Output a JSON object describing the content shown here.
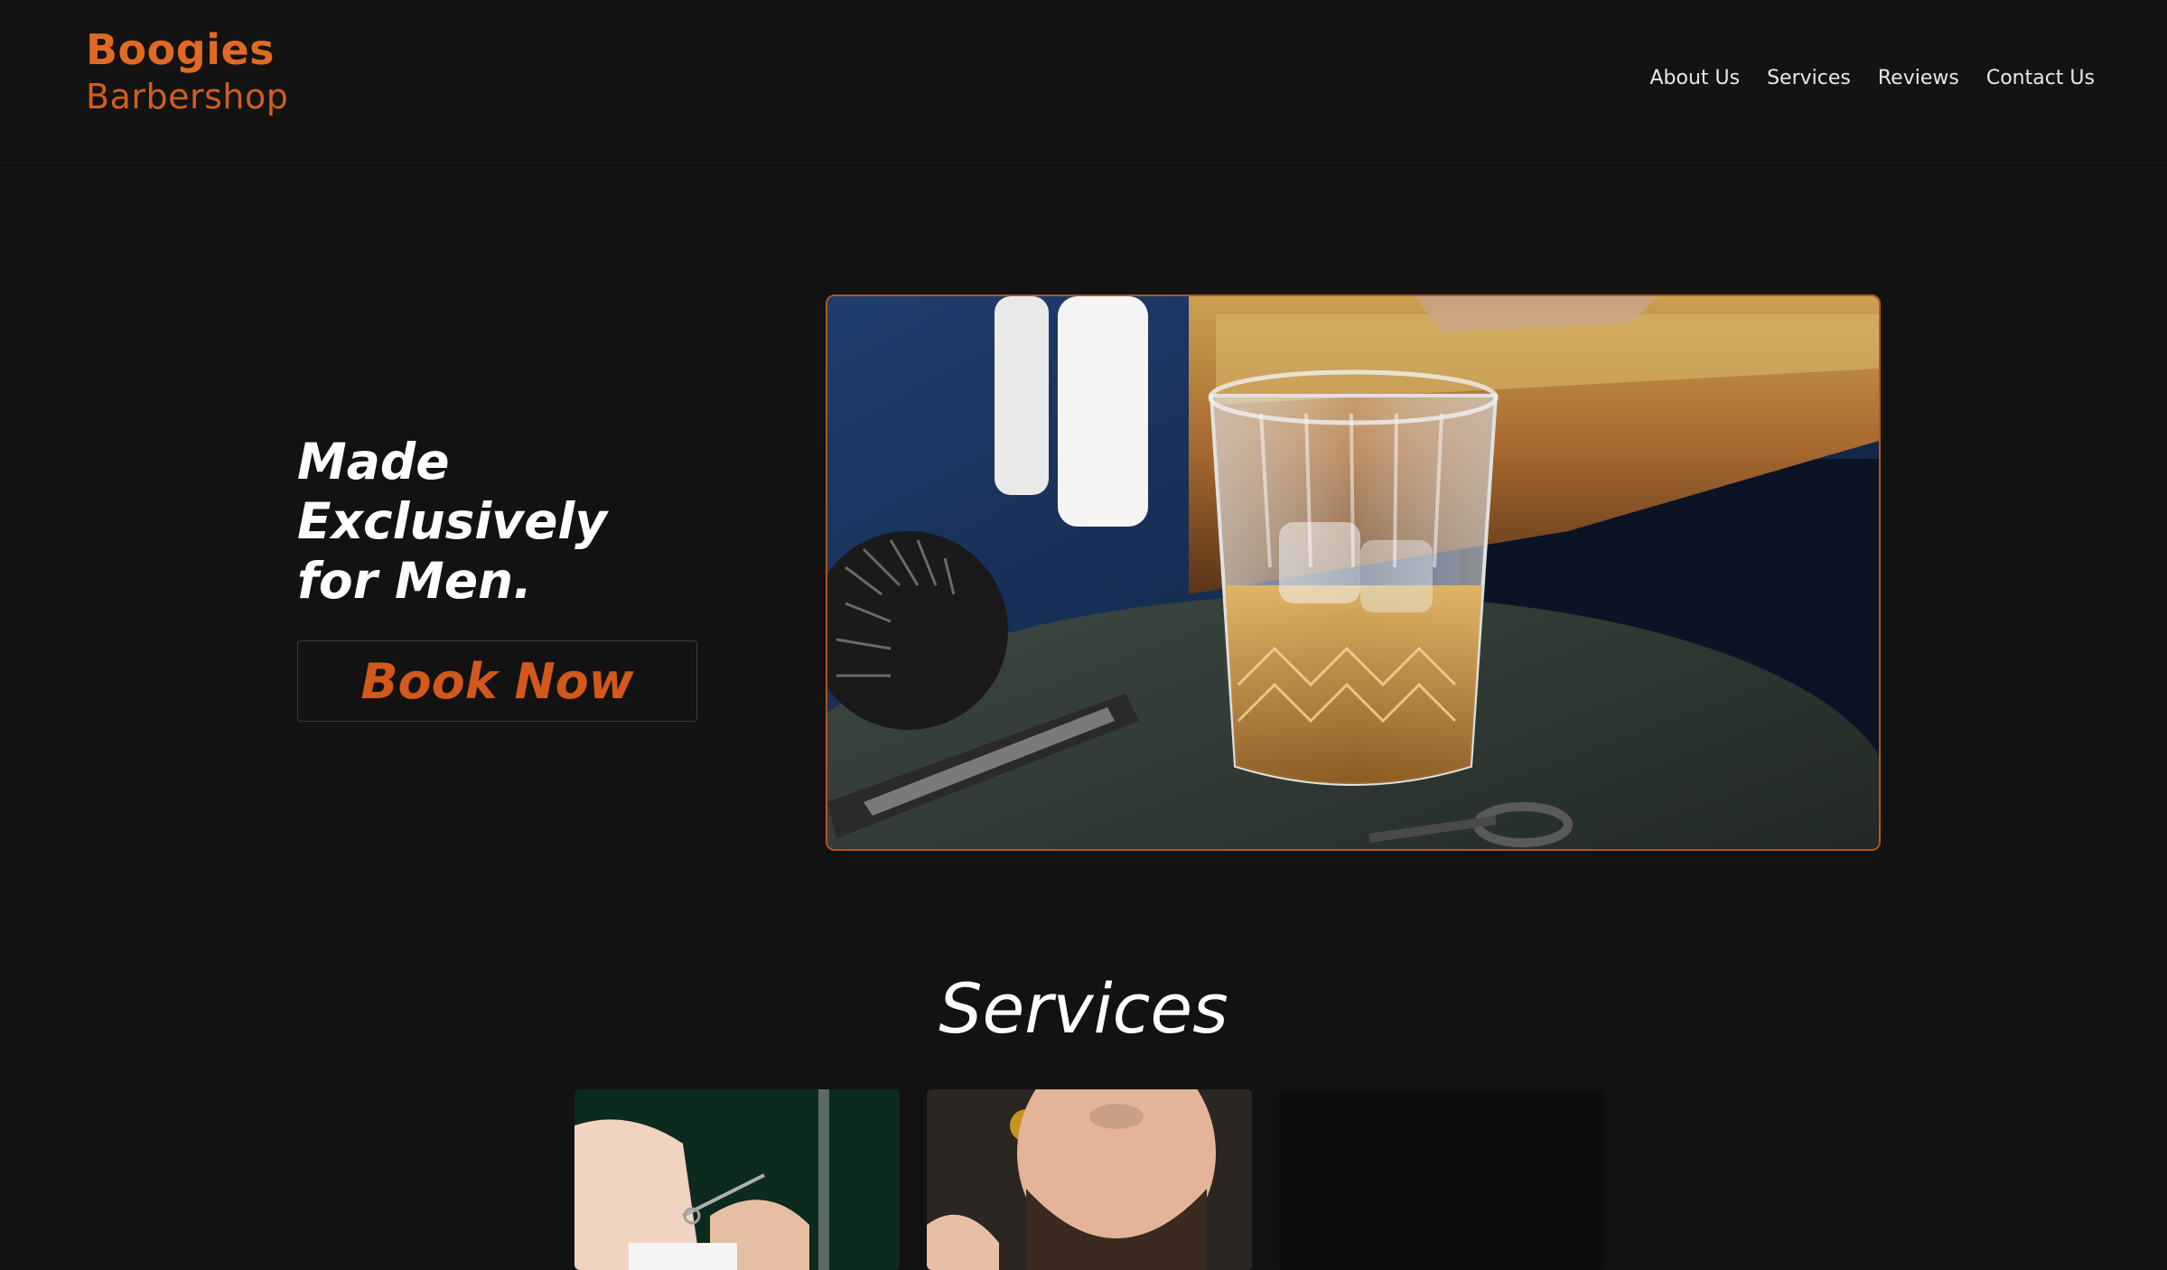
{
  "brand": {
    "name": "Boogies",
    "subtitle": "Barbershop"
  },
  "nav": {
    "items": [
      {
        "label": "About Us"
      },
      {
        "label": "Services"
      },
      {
        "label": "Reviews"
      },
      {
        "label": "Contact Us"
      }
    ]
  },
  "hero": {
    "headline_lines": [
      "Made",
      "Exclusively",
      "for Men."
    ],
    "cta_label": "Book Now",
    "image_subject": "whiskey-glass-barber-tools-photo"
  },
  "services": {
    "title": "Services",
    "cards": [
      {
        "image_subject": "barber-trimming-photo"
      },
      {
        "image_subject": "bearded-man-photo"
      },
      {
        "image_subject": "dark-photo"
      }
    ]
  },
  "colors": {
    "background": "#121212",
    "accent": "#e06a24",
    "accent_dark": "#d2581b",
    "text": "#ffffff"
  }
}
